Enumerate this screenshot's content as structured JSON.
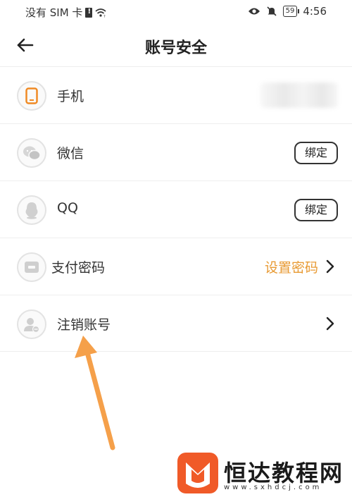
{
  "status_bar": {
    "carrier": "没有 SIM 卡",
    "battery": "59",
    "time": "4:56"
  },
  "nav": {
    "title": "账号安全",
    "back_icon": "arrow-left-icon"
  },
  "rows": [
    {
      "icon": "phone-icon",
      "label": "手机"
    },
    {
      "icon": "wechat-icon",
      "label": "微信",
      "action": "绑定"
    },
    {
      "icon": "qq-icon",
      "label": "QQ",
      "action": "绑定"
    },
    {
      "icon": "wallet-icon",
      "label": "支付密码",
      "value": "设置密码",
      "value_color": "#e89a33"
    },
    {
      "icon": "user-cancel-icon",
      "label": "注销账号"
    }
  ],
  "annotation": {
    "arrow_color": "#f5a04a"
  },
  "watermark": {
    "title": "恒达教程网",
    "url": "www.sxhdcj.com",
    "logo_color": "#f05a28"
  }
}
